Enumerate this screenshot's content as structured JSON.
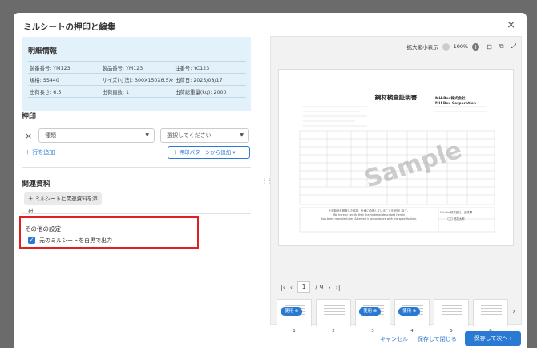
{
  "title": "ミルシートの押印と編集",
  "close_label": "×",
  "details": {
    "heading": "明細情報",
    "rows": [
      [
        "製番番号: YM123",
        "製品番号: YM123",
        "注番号: YC123"
      ],
      [
        "規格: SS440",
        "サイズ(寸法): 300X150X6.5X9",
        "出荷日: 2025/08/17"
      ],
      [
        "出荷長さ: 6.5",
        "出荷員数: 1",
        "出荷総重量(kg): 2000"
      ]
    ]
  },
  "stamp": {
    "heading": "押印",
    "remove_label": "×",
    "type_placeholder": "種類",
    "choice_placeholder": "選択してください",
    "add_row": "＋ 行を追加",
    "add_pattern": "＋ 押印パターンから追加 ▾"
  },
  "related": {
    "heading": "関連資料",
    "attach_button": "＋ ミルシートに関連資料を添付"
  },
  "other": {
    "heading": "その他の設定",
    "checkbox_label": "元のミルシートを白黒で出力",
    "checked": true
  },
  "preview": {
    "zoom_label": "拡大縮小表示",
    "zoom_value": "100%",
    "doc_title": "鋼材検査証明書",
    "doc_company_1": "MH-Box株式会社",
    "doc_company_2": "MH Box Corporation",
    "watermark": "Sample",
    "doc_footer_1": "上記製品を検査した結果、仕様に合格していることを証明します。",
    "doc_footer_2": "We hereby certify that the material described herein",
    "doc_footer_3": "has been manufactured & tested in accordance with the specification.",
    "doc_sign_1": "MH-Box株式会社　品質課",
    "doc_sign_2": "〇〇 品質太郎"
  },
  "pager": {
    "first": "|‹",
    "prev": "‹",
    "current": "1",
    "total": "/ 9",
    "next": "›",
    "last": "›|"
  },
  "thumbnails": [
    {
      "num": "1",
      "badge": "使用 ⊗",
      "used": true
    },
    {
      "num": "2",
      "badge": "",
      "used": false
    },
    {
      "num": "3",
      "badge": "使用 ⊗",
      "used": true
    },
    {
      "num": "4",
      "badge": "使用 ⊗",
      "used": true
    },
    {
      "num": "5",
      "badge": "",
      "used": false
    },
    {
      "num": "6",
      "badge": "",
      "used": false
    }
  ],
  "footer": {
    "cancel": "キャンセル",
    "save_close": "保存して閉じる",
    "save_next": "保存して次へ ›"
  },
  "colors": {
    "accent": "#2a7ad3",
    "highlight_border": "#e02020",
    "info_bg": "#e2f1fa"
  }
}
